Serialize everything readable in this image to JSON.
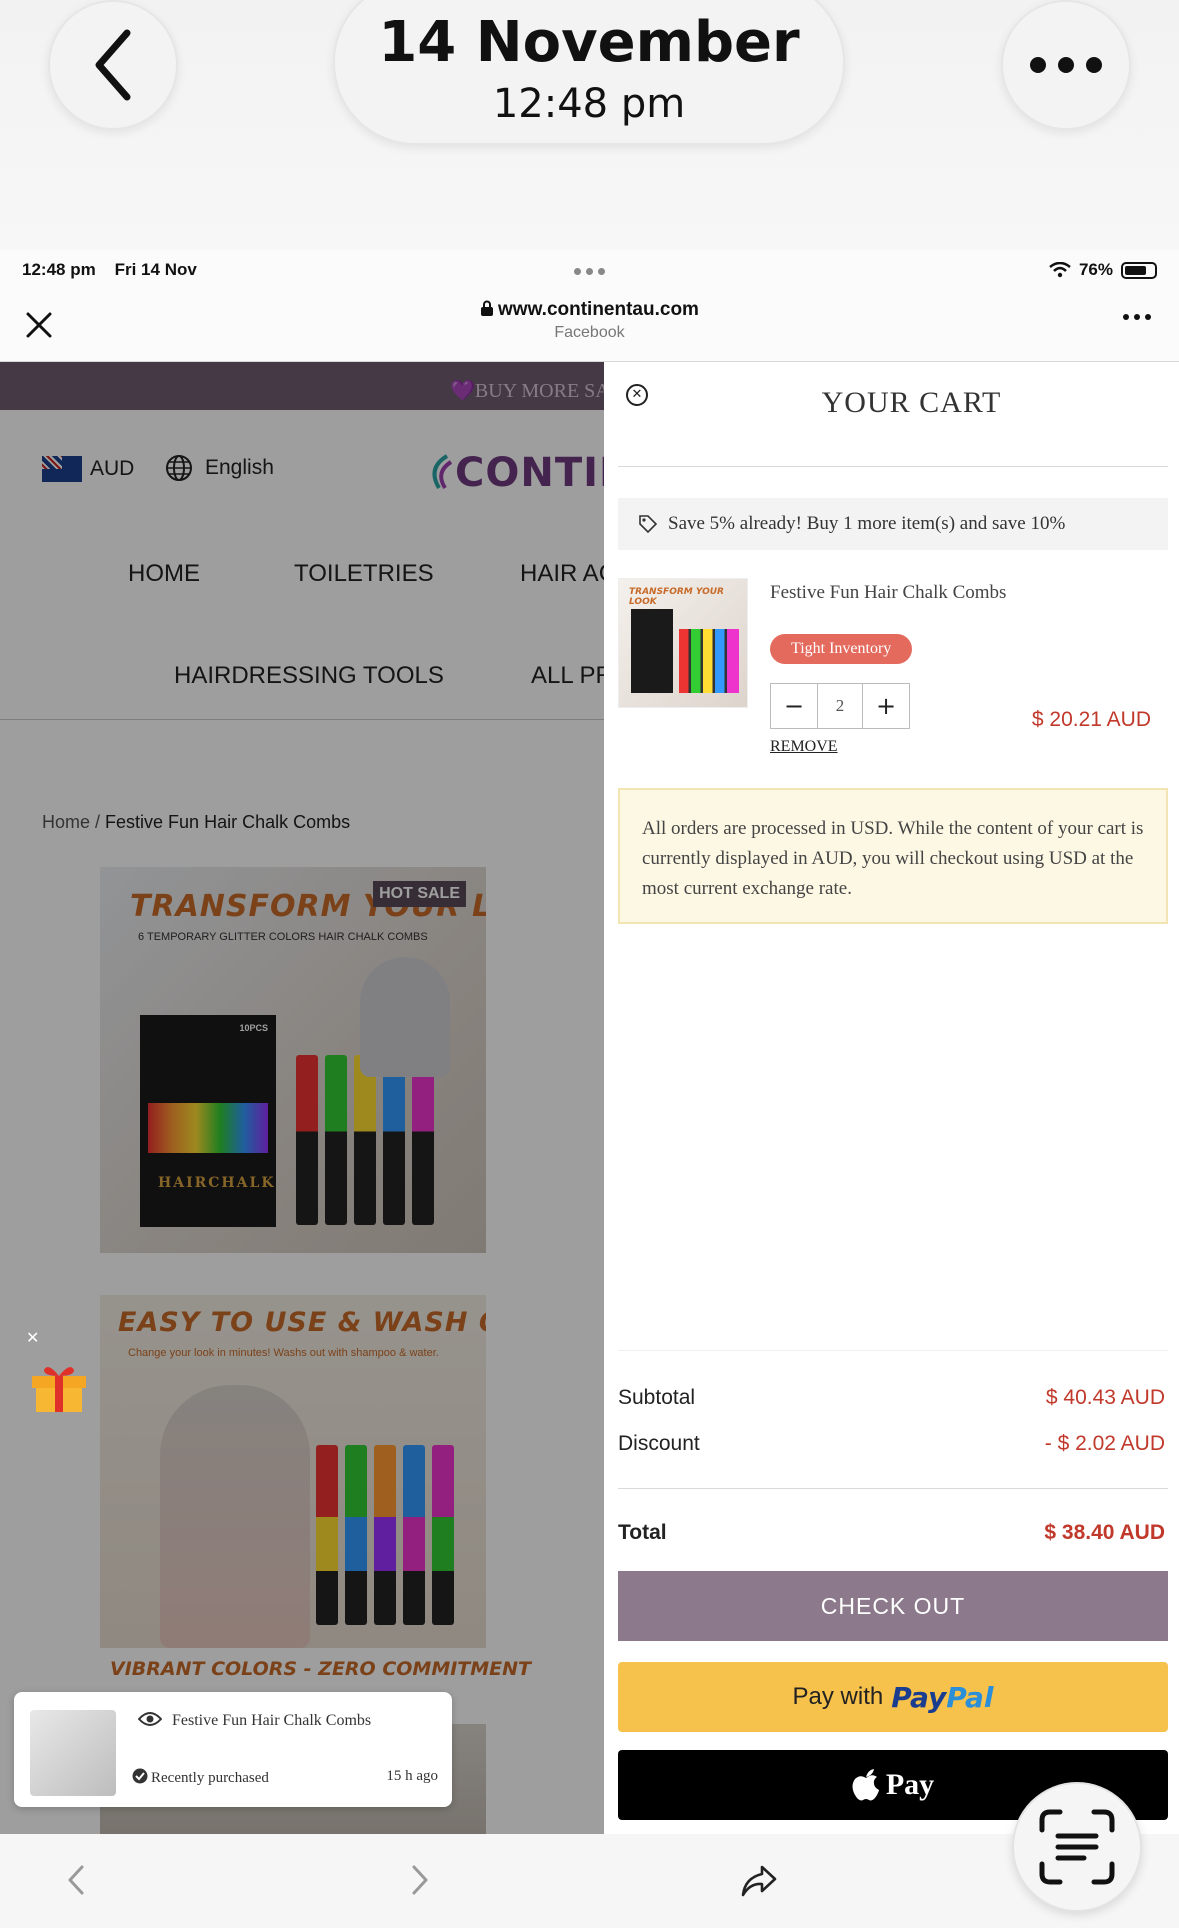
{
  "viewer": {
    "date": "14 November",
    "time": "12:48 pm"
  },
  "status_bar": {
    "time": "12:48 pm",
    "date": "Fri 14 Nov",
    "battery": "76%",
    "battery_level": 0.76
  },
  "browser": {
    "domain": "www.continentau.com",
    "source": "Facebook"
  },
  "site": {
    "banner": "💜BUY MORE SA",
    "currency": "AUD",
    "language": "English",
    "logo": "CONTIN",
    "nav": [
      "HOME",
      "TOILETRIES",
      "HAIR AC",
      "HAIRDRESSING TOOLS",
      "ALL PR"
    ],
    "breadcrumb_home": "Home",
    "breadcrumb_sep": " / ",
    "breadcrumb_current": "Festive Fun Hair Chalk Combs",
    "image1": {
      "title": "TRANSFORM YOUR LOOK",
      "badge": "HOT SALE",
      "subtitle": "6 TEMPORARY GLITTER COLORS HAIR CHALK COMBS",
      "box_label": "HAIRCHALK",
      "box_count": "10PCS"
    },
    "image2": {
      "title": "EASY TO USE & WASH OUT",
      "subtitle": "Change your look in minutes! Washs out with shampoo & water.",
      "footer": "VIBRANT COLORS - ZERO COMMITMENT"
    },
    "recent_purchase": {
      "product": "Festive Fun Hair Chalk Combs",
      "label": "Recently purchased",
      "ago": "15 h ago"
    }
  },
  "cart": {
    "title": "YOUR CART",
    "promo": "Save 5% already! Buy 1 more item(s) and save 10%",
    "item": {
      "name": "Festive Fun Hair Chalk Combs",
      "badge": "Tight Inventory",
      "quantity": "2",
      "remove": "REMOVE",
      "price": "$ 20.21 AUD"
    },
    "notice": "All orders are processed in USD. While the content of your cart is currently displayed in AUD, you will checkout using USD at the most current exchange rate.",
    "subtotal_label": "Subtotal",
    "subtotal_value": "$ 40.43 AUD",
    "discount_label": "Discount",
    "discount_value": "-  $ 2.02 AUD",
    "total_label": "Total",
    "total_value": "$ 38.40 AUD",
    "checkout_label": "CHECK OUT",
    "paypal_prefix": "Pay with",
    "paypal_brand_1": "Pay",
    "paypal_brand_2": "Pal",
    "applepay_label": "Pay"
  },
  "colors": {
    "price_red": "#c0392b",
    "checkout_bg": "#8c7a8c",
    "paypal_yellow": "#f6c24b",
    "badge_red": "#e46a5e"
  }
}
